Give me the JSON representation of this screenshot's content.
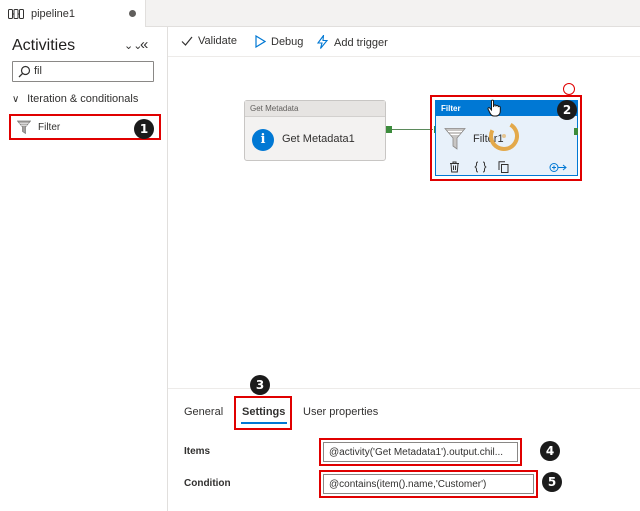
{
  "tab": {
    "title": "pipeline1"
  },
  "sidebar": {
    "title": "Activities",
    "collapse_icon": "double-chevron-down-icon",
    "hide_icon": "double-chevron-left-icon",
    "search": {
      "value": "fil"
    },
    "category": "Iteration & conditionals",
    "item": {
      "label": "Filter",
      "icon": "funnel-icon"
    }
  },
  "toolbar": {
    "validate": "Validate",
    "debug": "Debug",
    "add_trigger": "Add trigger"
  },
  "canvas": {
    "get_metadata": {
      "header": "Get Metadata",
      "label": "Get Metadata1"
    },
    "filter": {
      "header": "Filter",
      "label": "Filter1"
    }
  },
  "panel": {
    "tabs": [
      "General",
      "Settings",
      "User properties"
    ],
    "selected_tab": "Settings",
    "fields": [
      {
        "label": "Items",
        "value": "@activity('Get Metadata1').output.chil..."
      },
      {
        "label": "Condition",
        "value": "@contains(item().name,'Customer')"
      }
    ]
  },
  "callouts": [
    "1",
    "2",
    "3",
    "4",
    "5"
  ],
  "colors": {
    "accent": "#0078d4",
    "highlight": "#e00000",
    "badge": "#1b1b1b"
  }
}
